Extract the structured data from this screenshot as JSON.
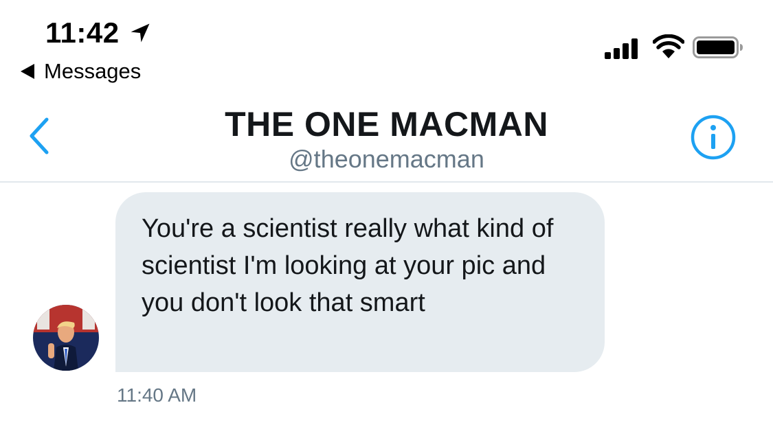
{
  "status_bar": {
    "time": "11:42",
    "back_app_label": "Messages",
    "icons": [
      "location-arrow-icon",
      "signal-icon",
      "wifi-icon",
      "battery-icon"
    ]
  },
  "header": {
    "title": "THE ONE MACMAN",
    "handle": "@theonemacman",
    "back_icon": "chevron-left-icon",
    "info_icon": "info-icon"
  },
  "conversation": {
    "message": {
      "text": "You're a scientist really what kind of scientist I'm looking at your pic and you don't look that smart",
      "timestamp": "11:40 AM"
    }
  },
  "colors": {
    "accent": "#1da1f2",
    "bubble_bg": "#e6ecf0",
    "secondary_text": "#657786",
    "divider": "#e1e8ed"
  }
}
